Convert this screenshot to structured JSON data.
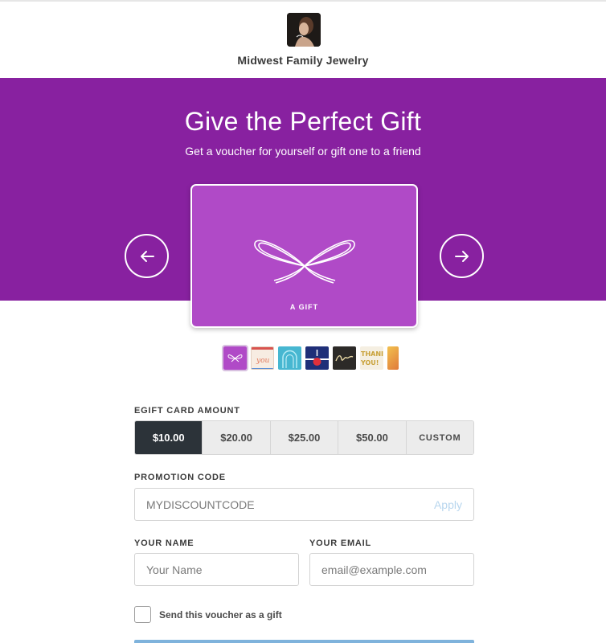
{
  "store": {
    "name": "Midwest Family Jewelry",
    "logo_icon": "merchant-logo-photo"
  },
  "hero": {
    "title": "Give the Perfect Gift",
    "subtitle": "Get a voucher for yourself or gift one to a friend",
    "background_color": "#8821a0",
    "prev_icon": "arrow-left-icon",
    "next_icon": "arrow-right-icon"
  },
  "card": {
    "label": "A GIFT",
    "icon": "ribbon-bow-icon",
    "color": "#b04ac7"
  },
  "designs": [
    {
      "name": "ribbon-bow",
      "selected": true
    },
    {
      "name": "you-airmail"
    },
    {
      "name": "blue-arch"
    },
    {
      "name": "navy-gift"
    },
    {
      "name": "thanks-script"
    },
    {
      "name": "thank-you-text"
    },
    {
      "name": "gold-partial"
    }
  ],
  "amount": {
    "label": "EGIFT CARD AMOUNT",
    "options": [
      "$10.00",
      "$20.00",
      "$25.00",
      "$50.00",
      "CUSTOM"
    ],
    "selected": "$10.00",
    "selected_color": "#2c3339"
  },
  "promo": {
    "label": "PROMOTION CODE",
    "placeholder": "MYDISCOUNTCODE",
    "apply_label": "Apply"
  },
  "name": {
    "label": "YOUR NAME",
    "placeholder": "Your Name"
  },
  "email": {
    "label": "YOUR EMAIL",
    "placeholder": "email@example.com"
  },
  "gift_option": {
    "label": "Send this voucher as a gift",
    "checked": false
  }
}
